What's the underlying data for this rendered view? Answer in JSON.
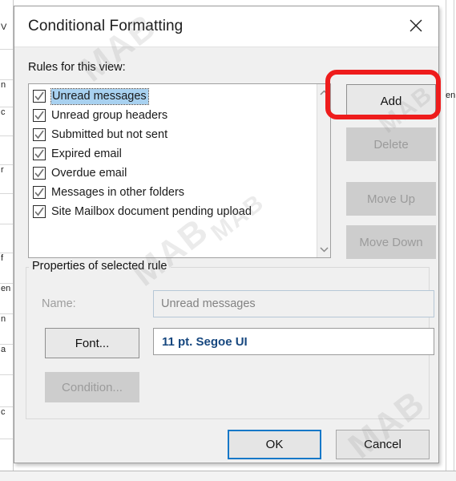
{
  "backdrop": {
    "left_fragments": [
      "V",
      "n",
      "c",
      "r",
      "f",
      "en",
      "n",
      "a",
      "c"
    ],
    "right_fragment": "en"
  },
  "dialog": {
    "title": "Conditional Formatting",
    "close_icon": "close-icon",
    "rules_label": "Rules for this view:",
    "rules": [
      {
        "label": "Unread messages",
        "checked": true,
        "selected": true
      },
      {
        "label": "Unread group headers",
        "checked": true,
        "selected": false
      },
      {
        "label": "Submitted but not sent",
        "checked": true,
        "selected": false
      },
      {
        "label": "Expired email",
        "checked": true,
        "selected": false
      },
      {
        "label": "Overdue email",
        "checked": true,
        "selected": false
      },
      {
        "label": "Messages in other folders",
        "checked": true,
        "selected": false
      },
      {
        "label": "Site Mailbox document pending upload",
        "checked": true,
        "selected": false
      }
    ],
    "scrollbar": {
      "up_icon": "chevron-up-icon",
      "down_icon": "chevron-down-icon"
    },
    "side_buttons": [
      {
        "label": "Add",
        "enabled": true,
        "highlighted": true
      },
      {
        "label": "Delete",
        "enabled": false,
        "highlighted": false
      },
      {
        "label": "Move Up",
        "enabled": false,
        "highlighted": false
      },
      {
        "label": "Move Down",
        "enabled": false,
        "highlighted": false
      }
    ],
    "properties": {
      "group_title": "Properties of selected rule",
      "name_label": "Name:",
      "name_value": "Unread messages",
      "font_button": "Font...",
      "font_value": "11 pt. Segoe UI",
      "condition_button": "Condition..."
    },
    "footer": {
      "ok": "OK",
      "cancel": "Cancel"
    }
  },
  "annotation": {
    "highlight_color": "#ee1c1c",
    "target": "Add"
  },
  "watermarks": [
    "MAB",
    "MAB",
    "MAB",
    "MAB",
    "MAB"
  ]
}
